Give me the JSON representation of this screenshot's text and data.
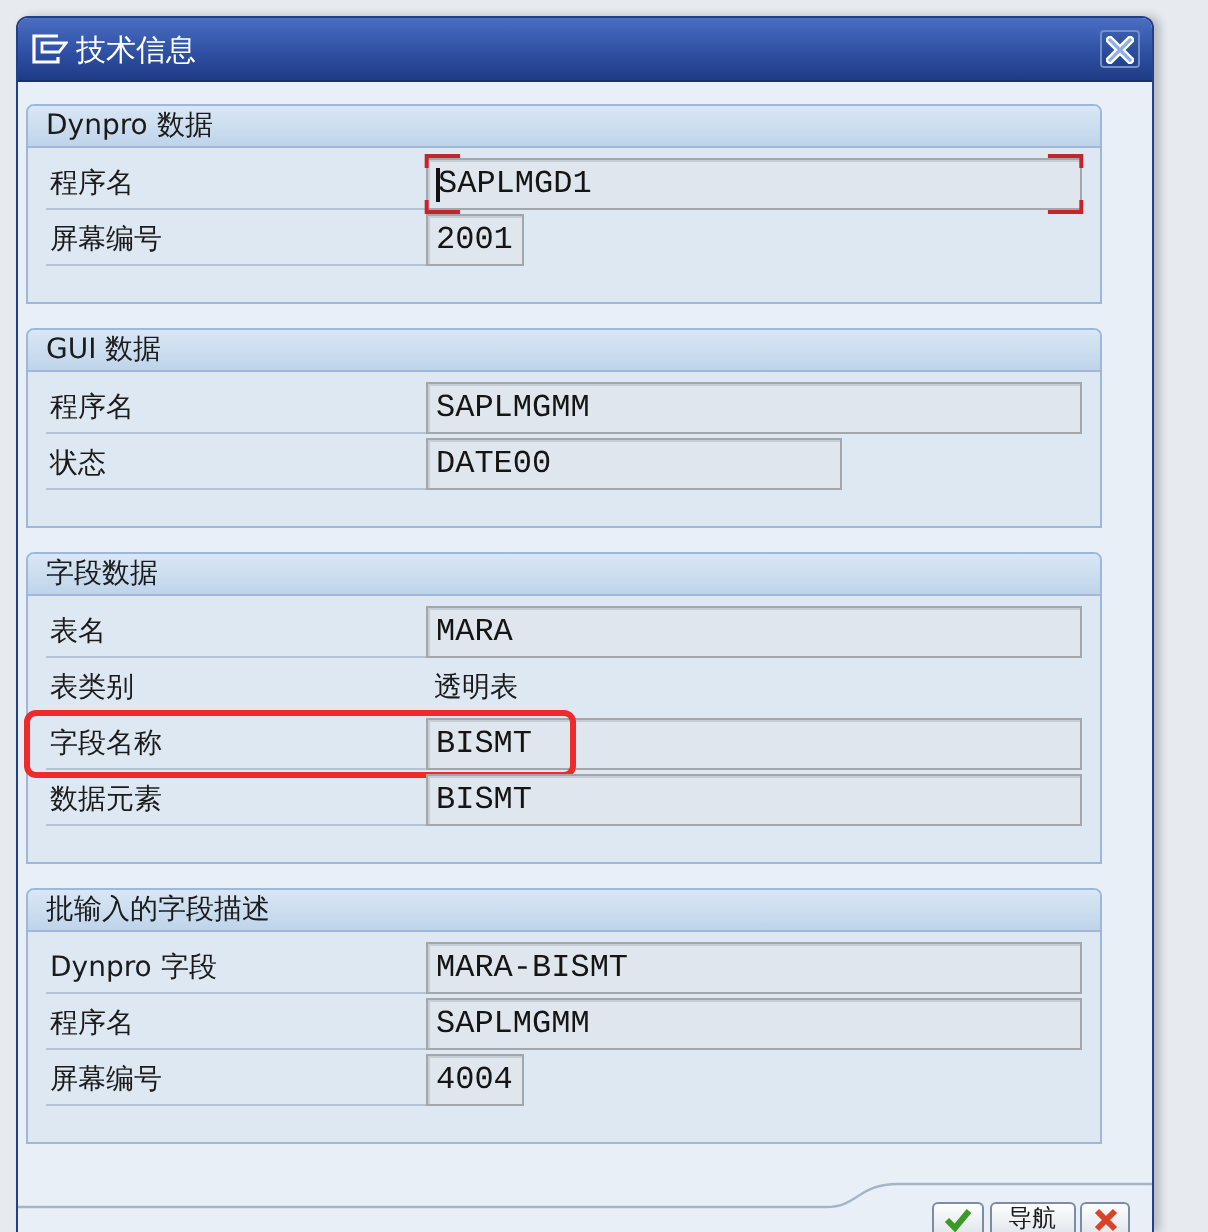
{
  "window": {
    "title": "技术信息"
  },
  "sections": [
    {
      "title": "Dynpro 数据",
      "rows": [
        {
          "label": "程序名",
          "kind": "long_field",
          "value": "SAPLMGD1",
          "focused": true,
          "highlighted": false
        },
        {
          "label": "屏幕编号",
          "kind": "short_field",
          "value": "2001",
          "focused": false,
          "highlighted": false
        }
      ]
    },
    {
      "title": "GUI 数据",
      "rows": [
        {
          "label": "程序名",
          "kind": "long_field",
          "value": "SAPLMGMM",
          "focused": false,
          "highlighted": false
        },
        {
          "label": "状态",
          "kind": "medium_field",
          "value": "DATE00",
          "focused": false,
          "highlighted": false
        }
      ]
    },
    {
      "title": "字段数据",
      "rows": [
        {
          "label": "表名",
          "kind": "long_field",
          "value": "MARA",
          "focused": false,
          "highlighted": false
        },
        {
          "label": "表类别",
          "kind": "text",
          "value": "透明表",
          "focused": false,
          "highlighted": false
        },
        {
          "label": "字段名称",
          "kind": "long_field",
          "value": "BISMT",
          "focused": false,
          "highlighted": true
        },
        {
          "label": "数据元素",
          "kind": "long_field",
          "value": "BISMT",
          "focused": false,
          "highlighted": false
        }
      ]
    },
    {
      "title": "批输入的字段描述",
      "rows": [
        {
          "label": "Dynpro 字段",
          "kind": "long_field",
          "value": "MARA-BISMT",
          "focused": false,
          "highlighted": false
        },
        {
          "label": "程序名",
          "kind": "long_field",
          "value": "SAPLMGMM",
          "focused": false,
          "highlighted": false
        },
        {
          "label": "屏幕编号",
          "kind": "short_field",
          "value": "4004",
          "focused": false,
          "highlighted": false
        }
      ]
    }
  ],
  "buttons": [
    {
      "kind": "confirm"
    },
    {
      "kind": "navigate",
      "label": "导航"
    },
    {
      "kind": "cancel"
    }
  ]
}
